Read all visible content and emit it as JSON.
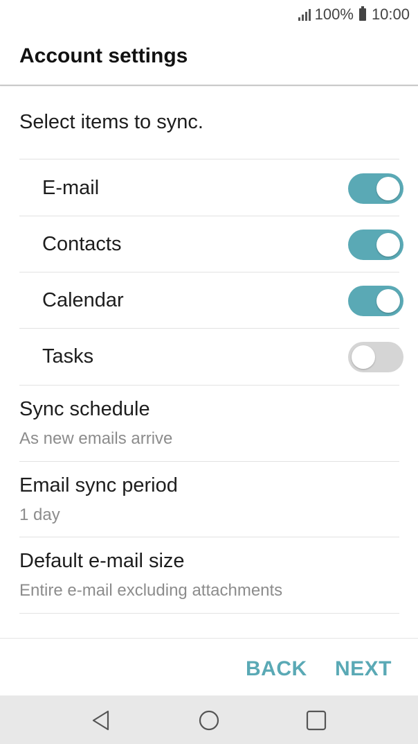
{
  "status_bar": {
    "battery": "100%",
    "time": "10:00"
  },
  "header": {
    "title": "Account settings"
  },
  "instructions": "Select items to sync.",
  "sync_items": [
    {
      "label": "E-mail",
      "enabled": true
    },
    {
      "label": "Contacts",
      "enabled": true
    },
    {
      "label": "Calendar",
      "enabled": true
    },
    {
      "label": "Tasks",
      "enabled": false
    }
  ],
  "settings": [
    {
      "title": "Sync schedule",
      "value": "As new emails arrive"
    },
    {
      "title": "Email sync period",
      "value": "1 day"
    },
    {
      "title": "Default e-mail size",
      "value": "Entire e-mail excluding attachments"
    }
  ],
  "footer": {
    "back_label": "BACK",
    "next_label": "NEXT"
  },
  "colors": {
    "accent": "#5aa9b5",
    "toggle_off": "#d5d5d5",
    "nav_bg": "#e8e8e8"
  },
  "icons": {
    "nav_back": "triangle-back-icon",
    "nav_home": "circle-home-icon",
    "nav_recent": "square-recent-icon"
  }
}
